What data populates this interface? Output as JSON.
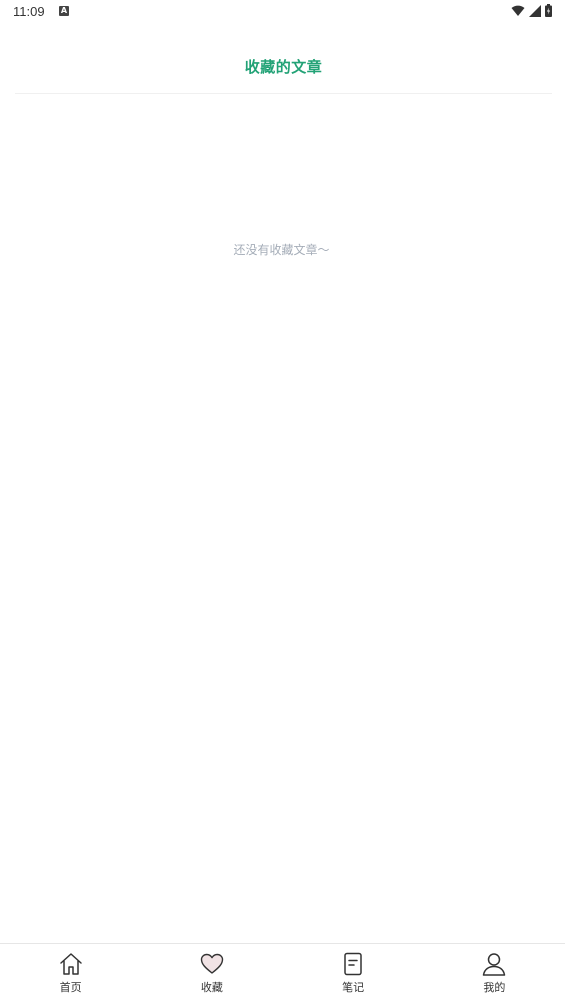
{
  "status_bar": {
    "time": "11:09",
    "notification_icon": "A",
    "icons": [
      "wifi-icon",
      "signal-icon",
      "battery-icon"
    ]
  },
  "header": {
    "title": "收藏的文章"
  },
  "empty_state": {
    "message": "还没有收藏文章～"
  },
  "bottom_nav": {
    "items": [
      {
        "label": "首页",
        "icon": "home-icon"
      },
      {
        "label": "收藏",
        "icon": "heart-icon",
        "active": true
      },
      {
        "label": "笔记",
        "icon": "note-icon"
      },
      {
        "label": "我的",
        "icon": "user-icon"
      }
    ]
  },
  "colors": {
    "accent": "#22a276",
    "empty_text": "#a5adb8",
    "heart_fill": "#f1e3e5"
  }
}
